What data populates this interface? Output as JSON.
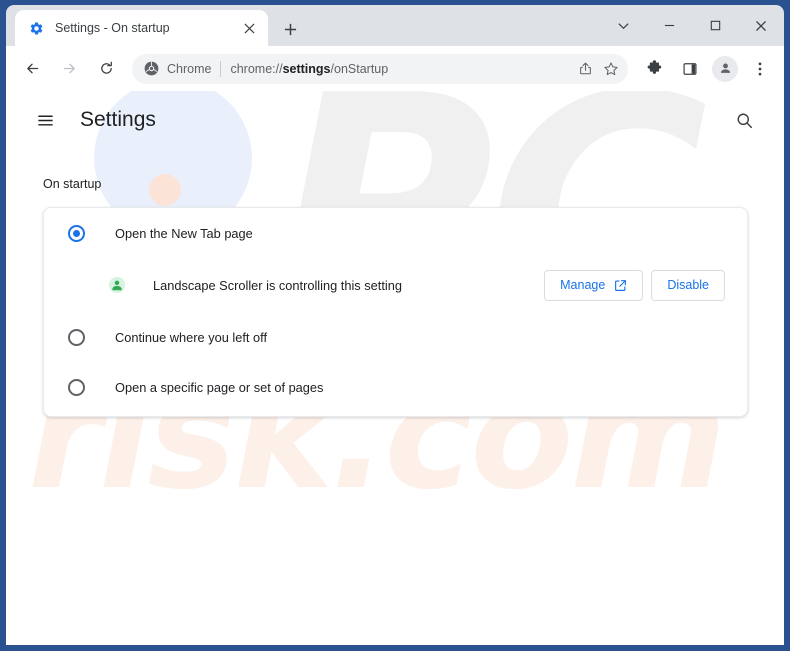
{
  "window": {
    "frame_color": "#2a5190",
    "controls": [
      {
        "name": "tab-search",
        "icon": "chevron-down-icon"
      },
      {
        "name": "minimize",
        "icon": "minimize-icon"
      },
      {
        "name": "maximize",
        "icon": "maximize-icon"
      },
      {
        "name": "close",
        "icon": "close-icon"
      }
    ]
  },
  "tabs": [
    {
      "title": "Settings - On startup",
      "favicon": "gear-icon",
      "active": true,
      "close_icon": "close-icon"
    }
  ],
  "new_tab_button": {
    "icon": "plus-icon",
    "label": "+"
  },
  "toolbar": {
    "back": {
      "icon": "arrow-left-icon",
      "enabled": true
    },
    "forward": {
      "icon": "arrow-right-icon",
      "enabled": false
    },
    "reload": {
      "icon": "reload-icon"
    },
    "omnibox": {
      "chrome_icon": "chrome-logo-icon",
      "chip_label": "Chrome",
      "url_prefix": "chrome://",
      "url_bold": "settings",
      "url_suffix": "/onStartup",
      "share_icon": "share-icon",
      "bookmark_icon": "star-icon"
    },
    "extensions_icon": "puzzle-icon",
    "side_panel_icon": "side-panel-icon",
    "profile_icon": "avatar-icon",
    "menu_icon": "three-dot-menu-icon"
  },
  "page": {
    "menu_icon": "hamburger-icon",
    "title": "Settings",
    "search_icon": "search-icon",
    "section_label": "On startup",
    "accent_color": "#1a73e8",
    "options": [
      {
        "label": "Open the New Tab page",
        "selected": true
      },
      {
        "label": "Continue where you left off",
        "selected": false
      },
      {
        "label": "Open a specific page or set of pages",
        "selected": false
      }
    ],
    "extension_notice": {
      "icon": "extension-icon",
      "text": "Landscape Scroller is controlling this setting",
      "manage_label": "Manage",
      "manage_icon": "external-link-icon",
      "disable_label": "Disable"
    }
  },
  "watermark": {
    "top_text": "PC",
    "bottom_text": "risk.com"
  }
}
